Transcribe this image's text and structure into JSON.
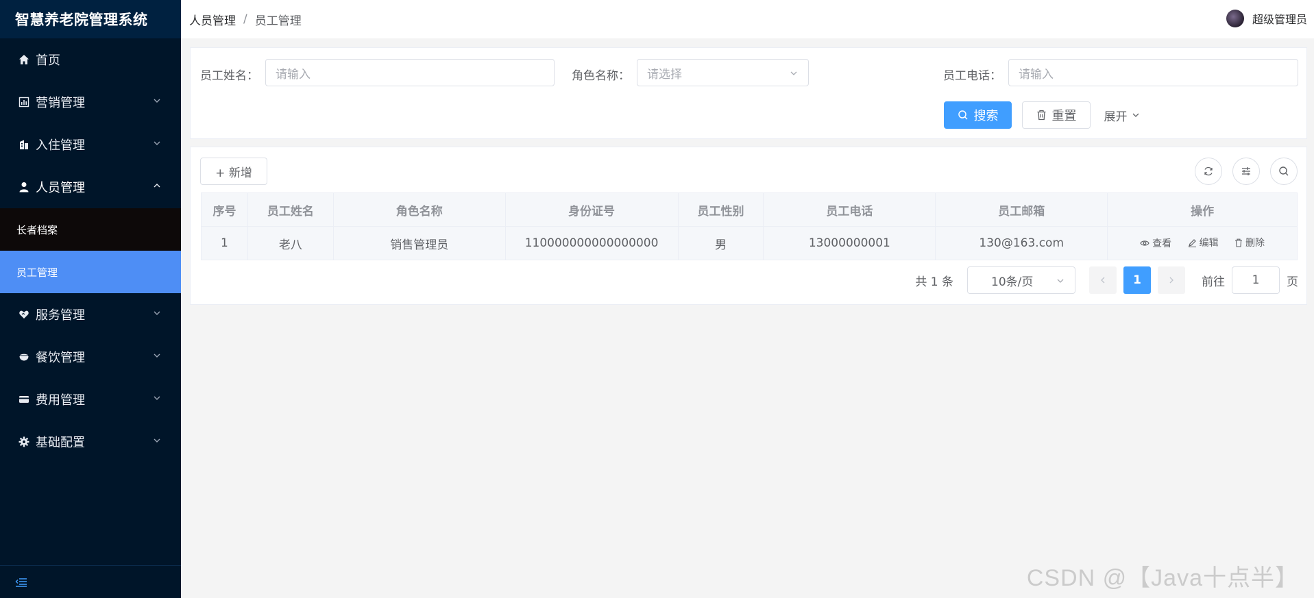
{
  "app": {
    "title": "智慧养老院管理系统"
  },
  "sidebar": {
    "items": [
      {
        "label": "首页",
        "icon": "home-icon"
      },
      {
        "label": "营销管理",
        "icon": "chart-icon"
      },
      {
        "label": "入住管理",
        "icon": "building-icon"
      },
      {
        "label": "人员管理",
        "icon": "user-icon"
      },
      {
        "label": "服务管理",
        "icon": "heart-hand-icon"
      },
      {
        "label": "餐饮管理",
        "icon": "bowl-icon"
      },
      {
        "label": "费用管理",
        "icon": "card-icon"
      },
      {
        "label": "基础配置",
        "icon": "gear-icon"
      }
    ],
    "sub_items": [
      {
        "label": "长者档案"
      },
      {
        "label": "员工管理"
      }
    ],
    "active_color": "#4e8ef5",
    "bg_color": "#001529"
  },
  "header": {
    "breadcrumb": [
      "人员管理",
      "员工管理"
    ],
    "separator": "/",
    "user_name": "超级管理员"
  },
  "search": {
    "name_label": "员工姓名：",
    "name_placeholder": "请输入",
    "role_label": "角色名称：",
    "role_placeholder": "请选择",
    "phone_label": "员工电话：",
    "phone_placeholder": "请输入",
    "search_button": "搜索",
    "reset_button": "重置",
    "expand_button": "展开"
  },
  "toolbar": {
    "add_button": "+ 新增"
  },
  "table": {
    "columns": [
      "序号",
      "员工姓名",
      "角色名称",
      "身份证号",
      "员工性别",
      "员工电话",
      "员工邮箱",
      "操作"
    ],
    "rows": [
      {
        "index": "1",
        "name": "老八",
        "role": "销售管理员",
        "id_no": "110000000000000000",
        "gender": "男",
        "phone": "13000000001",
        "email": "130@163.com"
      }
    ],
    "actions": {
      "view": "查看",
      "edit": "编辑",
      "delete": "删除"
    }
  },
  "pagination": {
    "total_text": "共 1 条",
    "page_size": "10条/页",
    "current_page": "1",
    "goto_label": "前往",
    "goto_value": "1",
    "page_suffix": "页"
  },
  "watermark": "CSDN @【Java十点半】",
  "colors": {
    "primary": "#409eff",
    "background": "#f4f4f4"
  }
}
